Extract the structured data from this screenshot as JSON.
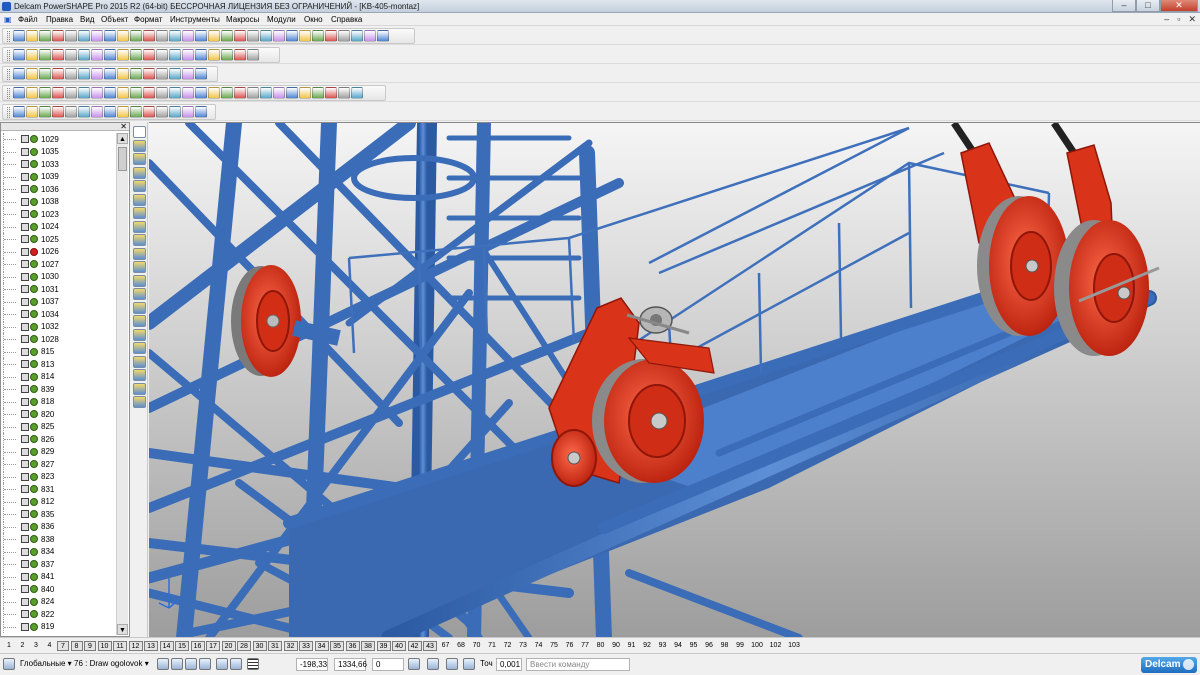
{
  "window": {
    "title": "Delcam PowerSHAPE Pro 2015 R2 (64-bit) БЕССРОЧНАЯ ЛИЦЕНЗИЯ БЕЗ ОГРАНИЧЕНИЙ - [KB-405-montaz]",
    "minimize": "–",
    "maximize": "□",
    "close": "✕"
  },
  "menu": {
    "items": [
      "Файл",
      "Правка",
      "Вид",
      "Объект",
      "Формат",
      "Инструменты",
      "Макросы",
      "Модули",
      "Окно",
      "Справка"
    ],
    "doc_controls": [
      "–",
      "▫",
      "✕"
    ]
  },
  "tree": {
    "items": [
      "1029",
      "1035",
      "1033",
      "1039",
      "1036",
      "1038",
      "1023",
      "1024",
      "1025",
      "1026",
      "1027",
      "1030",
      "1031",
      "1037",
      "1034",
      "1032",
      "1028",
      "815",
      "813",
      "814",
      "839",
      "818",
      "820",
      "825",
      "826",
      "829",
      "827",
      "823",
      "831",
      "812",
      "835",
      "836",
      "838",
      "834",
      "837",
      "841",
      "840",
      "824",
      "822",
      "819"
    ],
    "red_index": 9,
    "close_label": "✕"
  },
  "levels": {
    "items": [
      "1",
      "2",
      "3",
      "4",
      "7",
      "8",
      "9",
      "10",
      "11",
      "12",
      "13",
      "14",
      "15",
      "16",
      "17",
      "20",
      "28",
      "30",
      "31",
      "32",
      "33",
      "34",
      "35",
      "36",
      "38",
      "39",
      "40",
      "42",
      "43",
      "67",
      "68",
      "70",
      "71",
      "72",
      "73",
      "74",
      "75",
      "76",
      "77",
      "80",
      "90",
      "91",
      "92",
      "93",
      "94",
      "95",
      "96",
      "98",
      "99",
      "100",
      "102",
      "103"
    ],
    "boxed": [
      "7",
      "8",
      "9",
      "10",
      "11",
      "12",
      "13",
      "14",
      "15",
      "16",
      "17",
      "20",
      "28",
      "30",
      "31",
      "32",
      "33",
      "34",
      "35",
      "36",
      "38",
      "39",
      "40",
      "42",
      "43"
    ]
  },
  "status": {
    "workplane": "Глобальные",
    "dropdown_arrow": "▾",
    "level_combo": "76 : Draw ogolovok",
    "coord_x": "-198,33",
    "coord_y": "1334,66",
    "coord_z": "0",
    "tolerance_label": "Точ",
    "tolerance_value": "0,001",
    "command_placeholder": "Ввести команду"
  },
  "brand": {
    "logo_text": "Delcam"
  },
  "colors": {
    "structure_blue": "#4a7bc4",
    "structure_dark": "#2d5da6",
    "part_red": "#e63a1e",
    "background_top": "#f5f5f5",
    "background_bottom": "#9d9d9d"
  }
}
